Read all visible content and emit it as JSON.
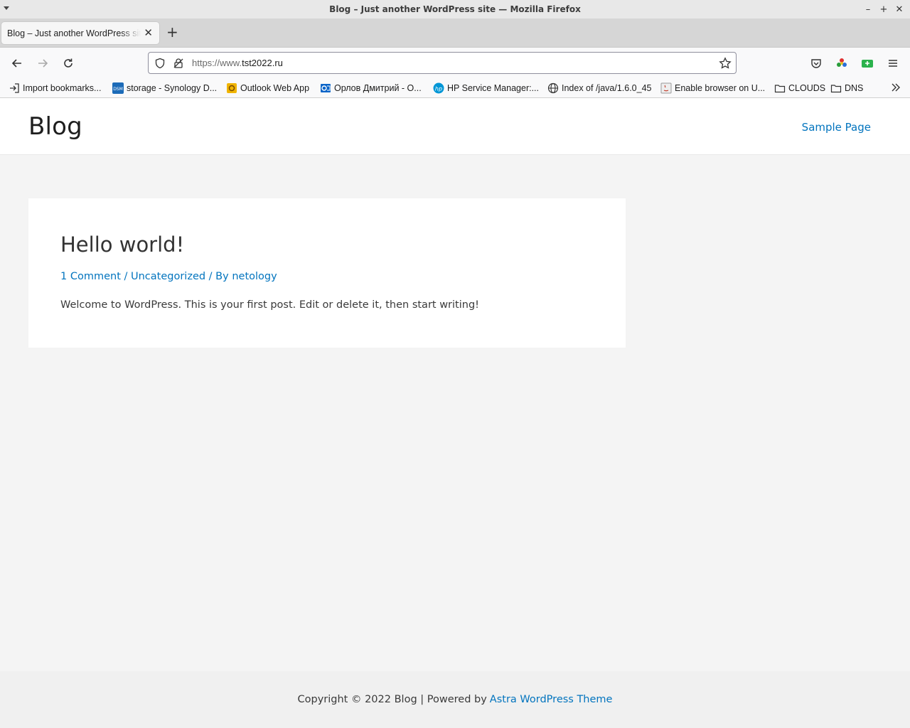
{
  "window": {
    "title": "Blog – Just another WordPress site — Mozilla Firefox"
  },
  "tabs": [
    {
      "label": "Blog – Just another WordPress site",
      "active": true
    }
  ],
  "urlbar": {
    "scheme": "https://www.",
    "host": "tst2022.ru"
  },
  "bookmarks": [
    {
      "label": "Import bookmarks...",
      "icon": "import-icon"
    },
    {
      "label": "storage - Synology D...",
      "icon": "dsm-icon"
    },
    {
      "label": "Outlook Web App",
      "icon": "owa-icon"
    },
    {
      "label": "Орлов Дмитрий - О...",
      "icon": "outlook-icon"
    },
    {
      "label": "HP Service Manager:...",
      "icon": "hp-icon"
    },
    {
      "label": "Index of /java/1.6.0_45",
      "icon": "globe-icon"
    },
    {
      "label": "Enable browser on U...",
      "icon": "java-icon"
    },
    {
      "label": "CLOUDS",
      "icon": "folder-icon"
    },
    {
      "label": "DNS",
      "icon": "folder-icon"
    }
  ],
  "site": {
    "title": "Blog",
    "nav": [
      "Sample Page"
    ]
  },
  "post": {
    "title": "Hello world!",
    "meta": {
      "comments": "1 Comment",
      "sep1": " / ",
      "category": "Uncategorized",
      "sep2": " / By ",
      "author": "netology"
    },
    "body": "Welcome to WordPress. This is your first post. Edit or delete it, then start writing!"
  },
  "footer": {
    "text": "Copyright © 2022 Blog | Powered by",
    "link": "Astra WordPress Theme"
  },
  "colors": {
    "link": "#0274be",
    "page_bg": "#f4f4f4"
  }
}
